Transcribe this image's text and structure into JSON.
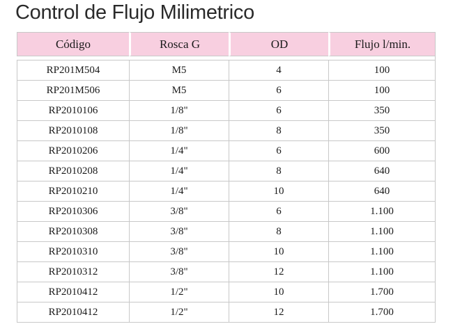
{
  "title": "Control de Flujo Milimetrico",
  "table": {
    "headers": [
      "Código",
      "Rosca G",
      "OD",
      "Flujo l/min."
    ],
    "rows": [
      [
        "RP201M504",
        "M5",
        "4",
        "100"
      ],
      [
        "RP201M506",
        "M5",
        "6",
        "100"
      ],
      [
        "RP2010106",
        "1/8\"",
        "6",
        "350"
      ],
      [
        "RP2010108",
        "1/8\"",
        "8",
        "350"
      ],
      [
        "RP2010206",
        "1/4\"",
        "6",
        "600"
      ],
      [
        "RP2010208",
        "1/4\"",
        "8",
        "640"
      ],
      [
        "RP2010210",
        "1/4\"",
        "10",
        "640"
      ],
      [
        "RP2010306",
        "3/8\"",
        "6",
        "1.100"
      ],
      [
        "RP2010308",
        "3/8\"",
        "8",
        "1.100"
      ],
      [
        "RP2010310",
        "3/8\"",
        "10",
        "1.100"
      ],
      [
        "RP2010312",
        "3/8\"",
        "12",
        "1.100"
      ],
      [
        "RP2010412",
        "1/2\"",
        "10",
        "1.700"
      ],
      [
        "RP2010412",
        "1/2\"",
        "12",
        "1.700"
      ]
    ]
  },
  "colors": {
    "header_bg": "#f8cfe0",
    "grid": "#c8c8c8"
  }
}
